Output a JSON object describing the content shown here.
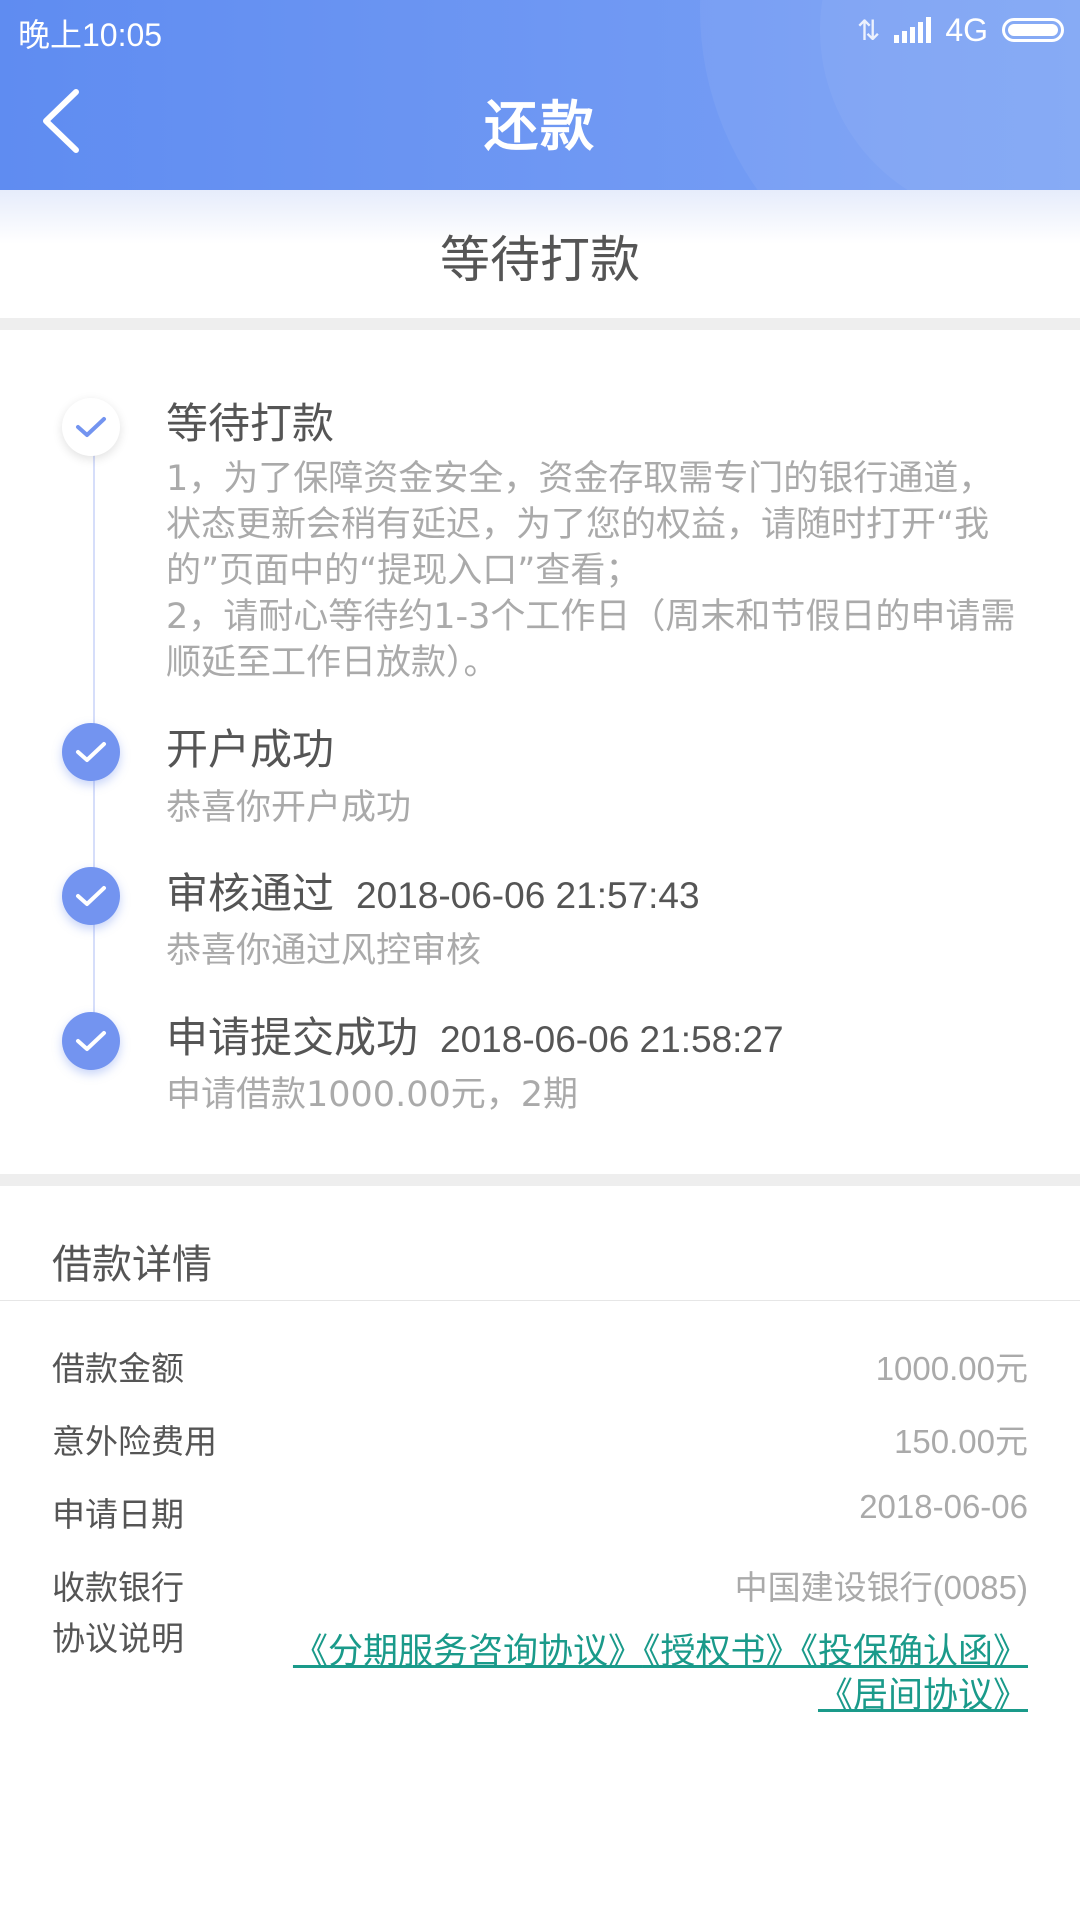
{
  "status_bar": {
    "time": "晚上10:05",
    "network": "4G"
  },
  "nav": {
    "title": "还款"
  },
  "current_status": "等待打款",
  "timeline": {
    "steps": [
      {
        "title": "等待打款",
        "time": "",
        "desc": "1，为了保障资金安全，资金存取需专门的银行通道，状态更新会稍有延迟，为了您的权益，请随时打开“我的”页面中的“提现入口”查看；\n2，请耐心等待约1-3个工作日（周末和节假日的申请需顺延至工作日放款）。"
      },
      {
        "title": "开户成功",
        "time": "",
        "desc": "恭喜你开户成功"
      },
      {
        "title": "审核通过",
        "time": "2018-06-06 21:57:43",
        "desc": "恭喜你通过风控审核"
      },
      {
        "title": "申请提交成功",
        "time": "2018-06-06 21:58:27",
        "desc": "申请借款1000.00元，2期"
      }
    ]
  },
  "details": {
    "title": "借款详情",
    "rows": [
      {
        "label": "借款金额",
        "value": "1000.00元"
      },
      {
        "label": "意外险费用",
        "value": "150.00元"
      },
      {
        "label": "申请日期",
        "value": "2018-06-06"
      },
      {
        "label": "收款银行",
        "value": "中国建设银行(0085)"
      }
    ],
    "agreement_label": "协议说明",
    "agreements": [
      "《分期服务咨询协议》",
      "《授权书》",
      "《投保确认函》",
      "《居间协议》"
    ]
  },
  "colors": {
    "header_blue": "#6a93f2",
    "check_blue": "#7394f0",
    "link_teal": "#1a9a8a"
  }
}
